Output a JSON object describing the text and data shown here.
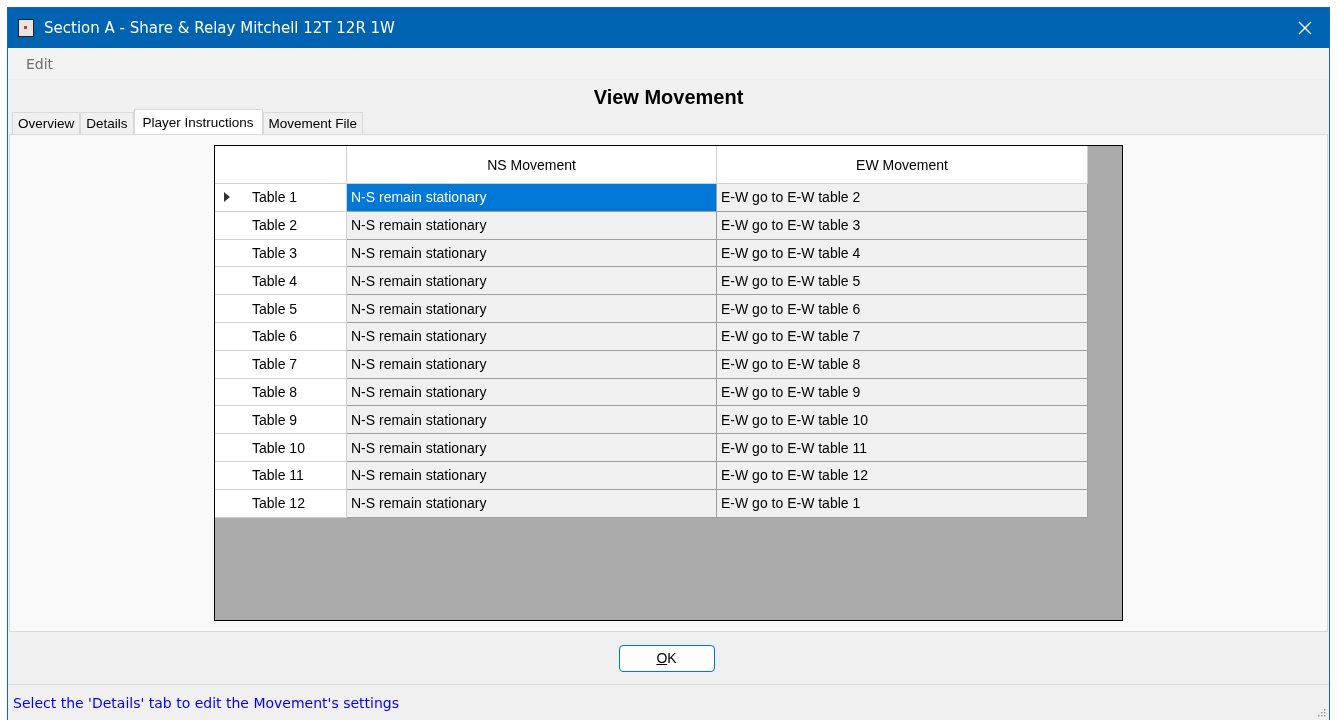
{
  "window": {
    "title": "Section A - Share & Relay Mitchell 12T 12R 1W"
  },
  "menu": [
    "Edit"
  ],
  "heading": "View Movement",
  "tabs": [
    {
      "label": "Overview",
      "selected": false
    },
    {
      "label": "Details",
      "selected": false
    },
    {
      "label": "Player Instructions",
      "selected": true
    },
    {
      "label": "Movement File",
      "selected": false
    }
  ],
  "table": {
    "columns": [
      "NS Movement",
      "EW Movement"
    ],
    "rows": [
      {
        "header": "Table 1",
        "current": true,
        "cells": [
          {
            "text": "N-S remain stationary",
            "selected": true
          },
          {
            "text": "E-W go to E-W table 2",
            "selected": false
          }
        ]
      },
      {
        "header": "Table 2",
        "current": false,
        "cells": [
          {
            "text": "N-S remain stationary",
            "selected": false
          },
          {
            "text": "E-W go to E-W table 3",
            "selected": false
          }
        ]
      },
      {
        "header": "Table 3",
        "current": false,
        "cells": [
          {
            "text": "N-S remain stationary",
            "selected": false
          },
          {
            "text": "E-W go to E-W table 4",
            "selected": false
          }
        ]
      },
      {
        "header": "Table 4",
        "current": false,
        "cells": [
          {
            "text": "N-S remain stationary",
            "selected": false
          },
          {
            "text": "E-W go to E-W table 5",
            "selected": false
          }
        ]
      },
      {
        "header": "Table 5",
        "current": false,
        "cells": [
          {
            "text": "N-S remain stationary",
            "selected": false
          },
          {
            "text": "E-W go to E-W table 6",
            "selected": false
          }
        ]
      },
      {
        "header": "Table 6",
        "current": false,
        "cells": [
          {
            "text": "N-S remain stationary",
            "selected": false
          },
          {
            "text": "E-W go to E-W table 7",
            "selected": false
          }
        ]
      },
      {
        "header": "Table 7",
        "current": false,
        "cells": [
          {
            "text": "N-S remain stationary",
            "selected": false
          },
          {
            "text": "E-W go to E-W table 8",
            "selected": false
          }
        ]
      },
      {
        "header": "Table 8",
        "current": false,
        "cells": [
          {
            "text": "N-S remain stationary",
            "selected": false
          },
          {
            "text": "E-W go to E-W table 9",
            "selected": false
          }
        ]
      },
      {
        "header": "Table 9",
        "current": false,
        "cells": [
          {
            "text": "N-S remain stationary",
            "selected": false
          },
          {
            "text": "E-W go to E-W table 10",
            "selected": false
          }
        ]
      },
      {
        "header": "Table 10",
        "current": false,
        "cells": [
          {
            "text": "N-S remain stationary",
            "selected": false
          },
          {
            "text": "E-W go to E-W table 11",
            "selected": false
          }
        ]
      },
      {
        "header": "Table 11",
        "current": false,
        "cells": [
          {
            "text": "N-S remain stationary",
            "selected": false
          },
          {
            "text": "E-W go to E-W table 12",
            "selected": false
          }
        ]
      },
      {
        "header": "Table 12",
        "current": false,
        "cells": [
          {
            "text": "N-S remain stationary",
            "selected": false
          },
          {
            "text": "E-W go to E-W table 1",
            "selected": false
          }
        ]
      }
    ]
  },
  "ok_button": {
    "label": "OK",
    "underline_first": true
  },
  "status_bar": "Select the 'Details' tab to edit the Movement's settings"
}
